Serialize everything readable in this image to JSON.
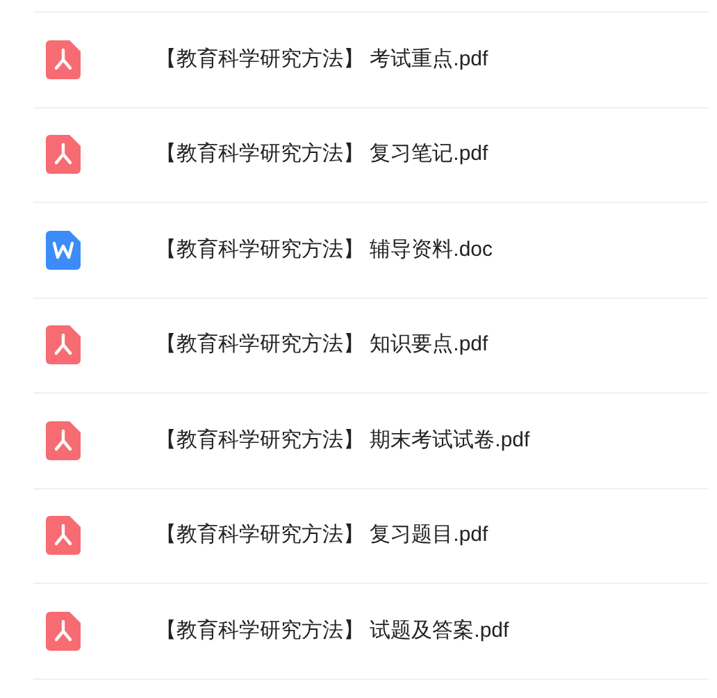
{
  "files": [
    {
      "kind": "pdf",
      "name": "【教育科学研究方法】 考试重点.pdf"
    },
    {
      "kind": "pdf",
      "name": "【教育科学研究方法】 复习笔记.pdf"
    },
    {
      "kind": "doc",
      "name": "【教育科学研究方法】 辅导资料.doc"
    },
    {
      "kind": "pdf",
      "name": "【教育科学研究方法】 知识要点.pdf"
    },
    {
      "kind": "pdf",
      "name": "【教育科学研究方法】 期末考试试卷.pdf"
    },
    {
      "kind": "pdf",
      "name": "【教育科学研究方法】 复习题目.pdf"
    },
    {
      "kind": "pdf",
      "name": "【教育科学研究方法】 试题及答案.pdf"
    }
  ]
}
